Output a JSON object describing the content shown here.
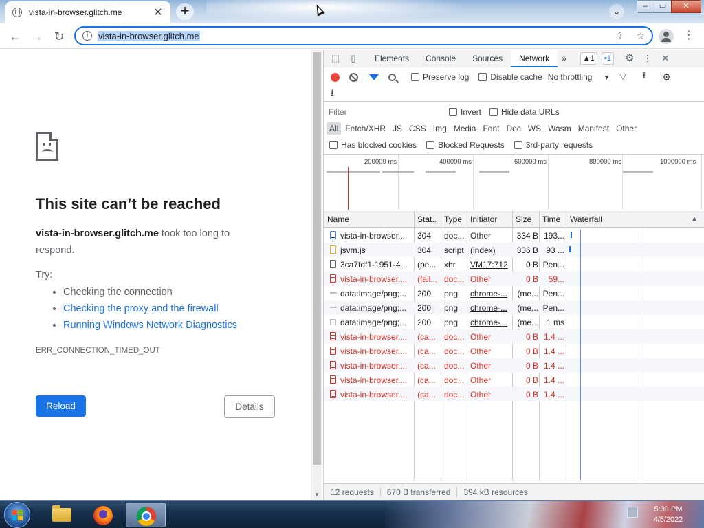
{
  "browser": {
    "tab_title": "vista-in-browser.glitch.me",
    "tab_close": "✕",
    "new_tab": "+",
    "tab_search": "⌄",
    "window_buttons": {
      "minimize": "–",
      "maximize": "▭",
      "close": "✕"
    },
    "back": "←",
    "forward": "→",
    "reload": "↻",
    "url": "vista-in-browser.glitch.me",
    "info_icon": "i",
    "share_icon": "⇪",
    "bookmark_icon": "☆",
    "menu_icon": "⋮"
  },
  "error_page": {
    "title": "This site can’t be reached",
    "host": "vista-in-browser.glitch.me",
    "message_rest": " took too long to respond.",
    "try_label": "Try:",
    "suggestions": [
      "Checking the connection",
      "Checking the proxy and the firewall",
      "Running Windows Network Diagnostics"
    ],
    "error_code": "ERR_CONNECTION_TIMED_OUT",
    "reload_label": "Reload",
    "details_label": "Details"
  },
  "devtools": {
    "tabs": [
      "Elements",
      "Console",
      "Sources",
      "Network"
    ],
    "more_tabs": "»",
    "active_tab": "Network",
    "warn_badge": "▲1",
    "msg_badge": "▪1",
    "settings_icon": "⚙",
    "kebab": "⋮",
    "close": "✕",
    "toolbar": {
      "preserve_log": "Preserve log",
      "disable_cache": "Disable cache",
      "throttling": "No throttling",
      "throttle_arrow": "▾",
      "wifi": "⌔",
      "upload": "⭱",
      "download": "⭳",
      "gear": "⚙"
    },
    "filter": {
      "placeholder": "Filter",
      "invert": "Invert",
      "hide_data_urls": "Hide data URLs"
    },
    "types": [
      "All",
      "Fetch/XHR",
      "JS",
      "CSS",
      "Img",
      "Media",
      "Font",
      "Doc",
      "WS",
      "Wasm",
      "Manifest",
      "Other"
    ],
    "checks": {
      "blocked_cookies": "Has blocked cookies",
      "blocked_requests": "Blocked Requests",
      "third_party": "3rd-party requests"
    },
    "overview_ticks": [
      "200000 ms",
      "400000 ms",
      "600000 ms",
      "800000 ms",
      "1000000 ms"
    ],
    "columns": {
      "name": "Name",
      "status": "Stat..",
      "type": "Type",
      "initiator": "Initiator",
      "size": "Size",
      "time": "Time",
      "waterfall": "Waterfall",
      "sort_arrow": "▲"
    },
    "requests": [
      {
        "name": "vista-in-browser....",
        "status": "304",
        "type": "doc...",
        "initiator": "Other",
        "size": "334 B",
        "time": "193...",
        "icon": "doc",
        "error": false,
        "link": false
      },
      {
        "name": "jsvm.js",
        "status": "304",
        "type": "script",
        "initiator": "(index)",
        "size": "336 B",
        "time": "93 ...",
        "icon": "js",
        "error": false,
        "link": true
      },
      {
        "name": "3ca7fdf1-1951-4...",
        "status": "(pe...",
        "type": "xhr",
        "initiator": "VM17:712",
        "size": "0 B",
        "time": "Pen...",
        "icon": "plain",
        "error": false,
        "link": true
      },
      {
        "name": "vista-in-browser....",
        "status": "(fail...",
        "type": "doc...",
        "initiator": "Other",
        "size": "0 B",
        "time": "59...",
        "icon": "err",
        "error": true,
        "link": false
      },
      {
        "name": "data:image/png;...",
        "status": "200",
        "type": "png",
        "initiator": "chrome-...",
        "size": "(me...",
        "time": "Pen...",
        "icon": "img",
        "error": false,
        "link": true
      },
      {
        "name": "data:image/png;...",
        "status": "200",
        "type": "png",
        "initiator": "chrome-...",
        "size": "(me...",
        "time": "Pen...",
        "icon": "img",
        "error": false,
        "link": true
      },
      {
        "name": "data:image/png;...",
        "status": "200",
        "type": "png",
        "initiator": "chrome-...",
        "size": "(me...",
        "time": "1 ms",
        "icon": "img2",
        "error": false,
        "link": true
      },
      {
        "name": "vista-in-browser....",
        "status": "(ca...",
        "type": "doc...",
        "initiator": "Other",
        "size": "0 B",
        "time": "1.4 ...",
        "icon": "err",
        "error": true,
        "link": false
      },
      {
        "name": "vista-in-browser....",
        "status": "(ca...",
        "type": "doc...",
        "initiator": "Other",
        "size": "0 B",
        "time": "1.4 ...",
        "icon": "err",
        "error": true,
        "link": false
      },
      {
        "name": "vista-in-browser....",
        "status": "(ca...",
        "type": "doc...",
        "initiator": "Other",
        "size": "0 B",
        "time": "1.4 ...",
        "icon": "err",
        "error": true,
        "link": false
      },
      {
        "name": "vista-in-browser....",
        "status": "(ca...",
        "type": "doc...",
        "initiator": "Other",
        "size": "0 B",
        "time": "1.4 ...",
        "icon": "err",
        "error": true,
        "link": false
      },
      {
        "name": "vista-in-browser....",
        "status": "(ca...",
        "type": "doc...",
        "initiator": "Other",
        "size": "0 B",
        "time": "1.4 ...",
        "icon": "err",
        "error": true,
        "link": false
      }
    ],
    "status": {
      "requests": "12 requests",
      "transferred": "670 B transferred",
      "resources": "394 kB resources"
    }
  },
  "taskbar": {
    "time": "5:39 PM",
    "date": "4/5/2022"
  },
  "colors": {
    "accent": "#1a73e8",
    "error": "#d93025",
    "record": "#e8443a"
  }
}
